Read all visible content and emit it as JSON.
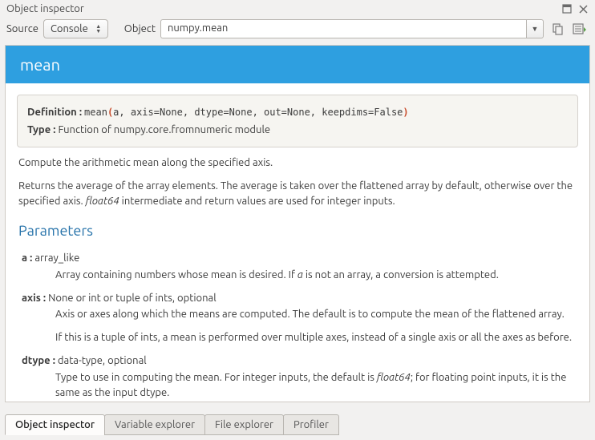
{
  "window": {
    "title": "Object inspector"
  },
  "toolbar": {
    "source_label": "Source",
    "source_value": "Console",
    "object_label": "Object",
    "object_value": "numpy.mean"
  },
  "doc": {
    "title": "mean",
    "def_label": "Definition :",
    "sig_fn": "mean",
    "sig_args_raw": "a, axis=None, dtype=None, out=None, keepdims=False",
    "type_label": "Type :",
    "type_value": "Function of numpy.core.fromnumeric module",
    "summary": "Compute the arithmetic mean along the specified axis.",
    "desc_pre": "Returns the average of the array elements. The average is taken over the flattened array by default, otherwise over the specified axis. ",
    "desc_ital": "float64",
    "desc_post": " intermediate and return values are used for integer inputs.",
    "params_heading": "Parameters",
    "params": {
      "a": {
        "name": "a :",
        "type": " array_like",
        "d1_pre": "Array containing numbers whose mean is desired. If ",
        "d1_ital": "a",
        "d1_post": " is not an array, a conversion is attempted."
      },
      "axis": {
        "name": "axis :",
        "type": " None or int or tuple of ints, optional",
        "d1": "Axis or axes along which the means are computed. The default is to compute the mean of the flattened array.",
        "d2": "If this is a tuple of ints, a mean is performed over multiple axes, instead of a single axis or all the axes as before."
      },
      "dtype": {
        "name": "dtype :",
        "type": " data-type, optional",
        "d1_pre": "Type to use in computing the mean. For integer inputs, the default is ",
        "d1_ital": "float64",
        "d1_post": "; for floating point inputs, it is the same as the input dtype."
      }
    }
  },
  "tabs": {
    "t0": "Object inspector",
    "t1": "Variable explorer",
    "t2": "File explorer",
    "t3": "Profiler"
  }
}
